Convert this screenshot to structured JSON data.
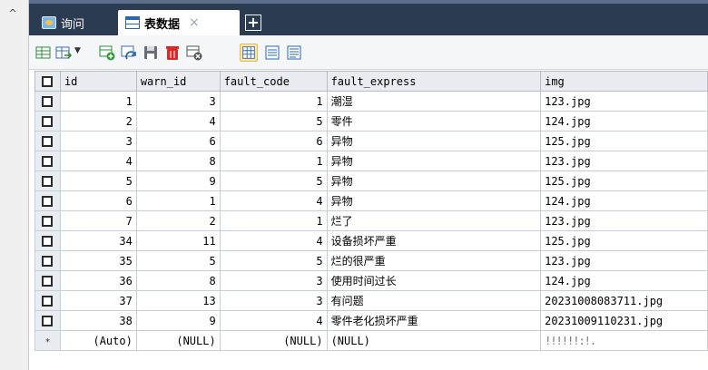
{
  "tabs": {
    "query_label": "询问",
    "table_label": "表数据",
    "close_symbol": "×",
    "add_symbol": "+"
  },
  "sidebar": {
    "collapse_symbol": "^"
  },
  "toolbar": {
    "icons": [
      "insert-row-icon",
      "export-icon",
      "add-row-icon",
      "refresh-icon",
      "save-icon",
      "delete-icon",
      "cancel-icon",
      "grid-view-icon",
      "form-view-icon",
      "text-view-icon"
    ],
    "selected": "grid-view-icon"
  },
  "grid": {
    "columns": [
      "id",
      "warn_id",
      "fault_code",
      "fault_express",
      "img"
    ],
    "rows": [
      {
        "id": "1",
        "warn_id": "3",
        "fault_code": "1",
        "fault_express": "潮湿",
        "img": "123.jpg"
      },
      {
        "id": "2",
        "warn_id": "4",
        "fault_code": "5",
        "fault_express": "零件",
        "img": "124.jpg"
      },
      {
        "id": "3",
        "warn_id": "6",
        "fault_code": "6",
        "fault_express": "异物",
        "img": "125.jpg"
      },
      {
        "id": "4",
        "warn_id": "8",
        "fault_code": "1",
        "fault_express": "异物",
        "img": "123.jpg"
      },
      {
        "id": "5",
        "warn_id": "9",
        "fault_code": "5",
        "fault_express": "异物",
        "img": "125.jpg"
      },
      {
        "id": "6",
        "warn_id": "1",
        "fault_code": "4",
        "fault_express": "异物",
        "img": "124.jpg"
      },
      {
        "id": "7",
        "warn_id": "2",
        "fault_code": "1",
        "fault_express": "烂了",
        "img": "123.jpg"
      },
      {
        "id": "34",
        "warn_id": "11",
        "fault_code": "4",
        "fault_express": "设备损坏严重",
        "img": "125.jpg"
      },
      {
        "id": "35",
        "warn_id": "5",
        "fault_code": "5",
        "fault_express": "烂的很严重",
        "img": "123.jpg"
      },
      {
        "id": "36",
        "warn_id": "8",
        "fault_code": "3",
        "fault_express": "使用时间过长",
        "img": "124.jpg"
      },
      {
        "id": "37",
        "warn_id": "13",
        "fault_code": "3",
        "fault_express": "有问题",
        "img": "20231008083711.jpg"
      },
      {
        "id": "38",
        "warn_id": "9",
        "fault_code": "4",
        "fault_express": "零件老化损坏严重",
        "img": "20231009110231.jpg"
      }
    ],
    "new_row": {
      "marker": "*",
      "id": "(Auto)",
      "warn_id": "(NULL)",
      "fault_code": "(NULL)",
      "fault_express": "(NULL)",
      "img": "!!!!!!:!."
    }
  }
}
